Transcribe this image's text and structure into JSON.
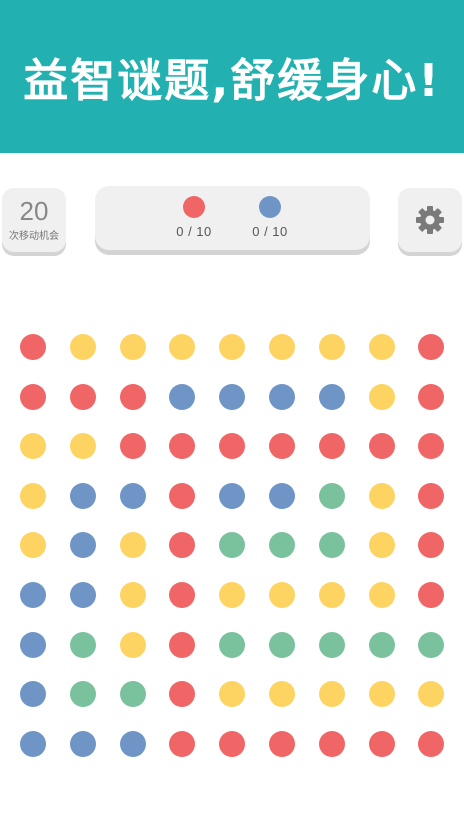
{
  "banner": {
    "title": "益智谜题,舒缓身心!"
  },
  "moves": {
    "count": "20",
    "label": "次移动机会"
  },
  "goals": [
    {
      "color": "red",
      "hex": "#f06565",
      "progress": "0 / 10"
    },
    {
      "color": "blue",
      "hex": "#6f95c6",
      "progress": "0 / 10"
    }
  ],
  "settings": {
    "icon": "gear-icon"
  },
  "palette": {
    "R": "#f06565",
    "Y": "#fdd462",
    "B": "#6f95c6",
    "G": "#7ac29e"
  },
  "board": {
    "rows": [
      [
        "R",
        "Y",
        "Y",
        "Y",
        "Y",
        "Y",
        "Y",
        "Y",
        "R"
      ],
      [
        "R",
        "R",
        "R",
        "B",
        "B",
        "B",
        "B",
        "Y",
        "R"
      ],
      [
        "Y",
        "Y",
        "R",
        "R",
        "R",
        "R",
        "R",
        "R",
        "R"
      ],
      [
        "Y",
        "B",
        "B",
        "R",
        "B",
        "B",
        "G",
        "Y",
        "R"
      ],
      [
        "Y",
        "B",
        "Y",
        "R",
        "G",
        "G",
        "G",
        "Y",
        "R"
      ],
      [
        "B",
        "B",
        "Y",
        "R",
        "Y",
        "Y",
        "Y",
        "Y",
        "R"
      ],
      [
        "B",
        "G",
        "Y",
        "R",
        "G",
        "G",
        "G",
        "G",
        "G"
      ],
      [
        "B",
        "G",
        "G",
        "R",
        "Y",
        "Y",
        "Y",
        "Y",
        "Y"
      ],
      [
        "B",
        "B",
        "B",
        "R",
        "R",
        "R",
        "R",
        "R",
        "R"
      ]
    ]
  }
}
